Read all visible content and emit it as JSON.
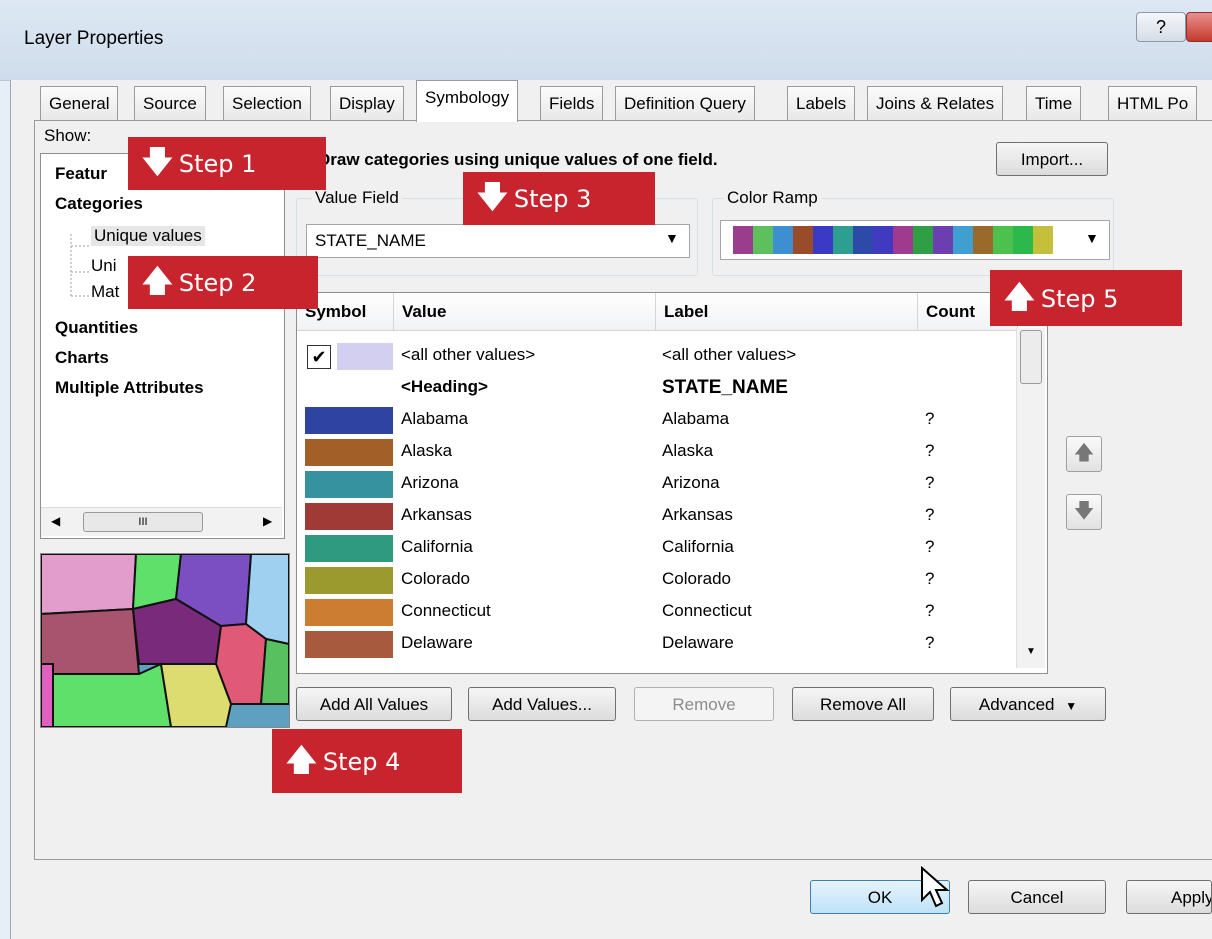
{
  "window": {
    "title": "Layer Properties",
    "help_label": "?"
  },
  "tabs": [
    "General",
    "Source",
    "Selection",
    "Display",
    "Symbology",
    "Fields",
    "Definition Query",
    "Labels",
    "Joins & Relates",
    "Time",
    "HTML Po"
  ],
  "show": {
    "label": "Show:",
    "items": {
      "features": "Featur",
      "categories": "Categories",
      "unique_values": "Unique values",
      "unique_many": "Uni",
      "match": "Mat",
      "quantities": "Quantities",
      "charts": "Charts",
      "multiple": "Multiple Attributes"
    },
    "scroll_thumb": "III"
  },
  "description": "Draw categories using unique values of one field.",
  "import_label": "Import...",
  "value_field": {
    "label": "Value Field",
    "value": "STATE_NAME"
  },
  "color_ramp": {
    "label": "Color Ramp",
    "colors": [
      "#9b3d8d",
      "#5dc05d",
      "#3e8fd0",
      "#9a4c2a",
      "#3a3ac4",
      "#2e9e91",
      "#2e4aa8",
      "#3f3ac0",
      "#a03a8f",
      "#2f9e45",
      "#6b3fb0",
      "#3e9fd0",
      "#9a6a2d",
      "#4ec04e",
      "#2cb84a",
      "#c3c13c"
    ]
  },
  "grid": {
    "headers": {
      "symbol": "Symbol",
      "value": "Value",
      "label": "Label",
      "count": "Count"
    },
    "other": {
      "value": "<all other values>",
      "label": "<all other values>",
      "color": "#d3cff0"
    },
    "heading": {
      "value": "<Heading>",
      "label": "STATE_NAME"
    },
    "rows": [
      {
        "value": "Alabama",
        "label": "Alabama",
        "count": "?",
        "color": "#2f44a2"
      },
      {
        "value": "Alaska",
        "label": "Alaska",
        "count": "?",
        "color": "#a26028"
      },
      {
        "value": "Arizona",
        "label": "Arizona",
        "count": "?",
        "color": "#36929e"
      },
      {
        "value": "Arkansas",
        "label": "Arkansas",
        "count": "?",
        "color": "#a03a36"
      },
      {
        "value": "California",
        "label": "California",
        "count": "?",
        "color": "#2f9a7f"
      },
      {
        "value": "Colorado",
        "label": "Colorado",
        "count": "?",
        "color": "#9a9a2e"
      },
      {
        "value": "Connecticut",
        "label": "Connecticut",
        "count": "?",
        "color": "#cc7d32"
      },
      {
        "value": "Delaware",
        "label": "Delaware",
        "count": "?",
        "color": "#a85a3e"
      }
    ]
  },
  "buttons": {
    "add_all": "Add All Values",
    "add_values": "Add Values...",
    "remove": "Remove",
    "remove_all": "Remove All",
    "advanced": "Advanced",
    "ok": "OK",
    "cancel": "Cancel",
    "apply": "Apply"
  },
  "callouts": {
    "step1": "Step 1",
    "step2": "Step 2",
    "step3": "Step 3",
    "step4": "Step 4",
    "step5": "Step 5"
  }
}
